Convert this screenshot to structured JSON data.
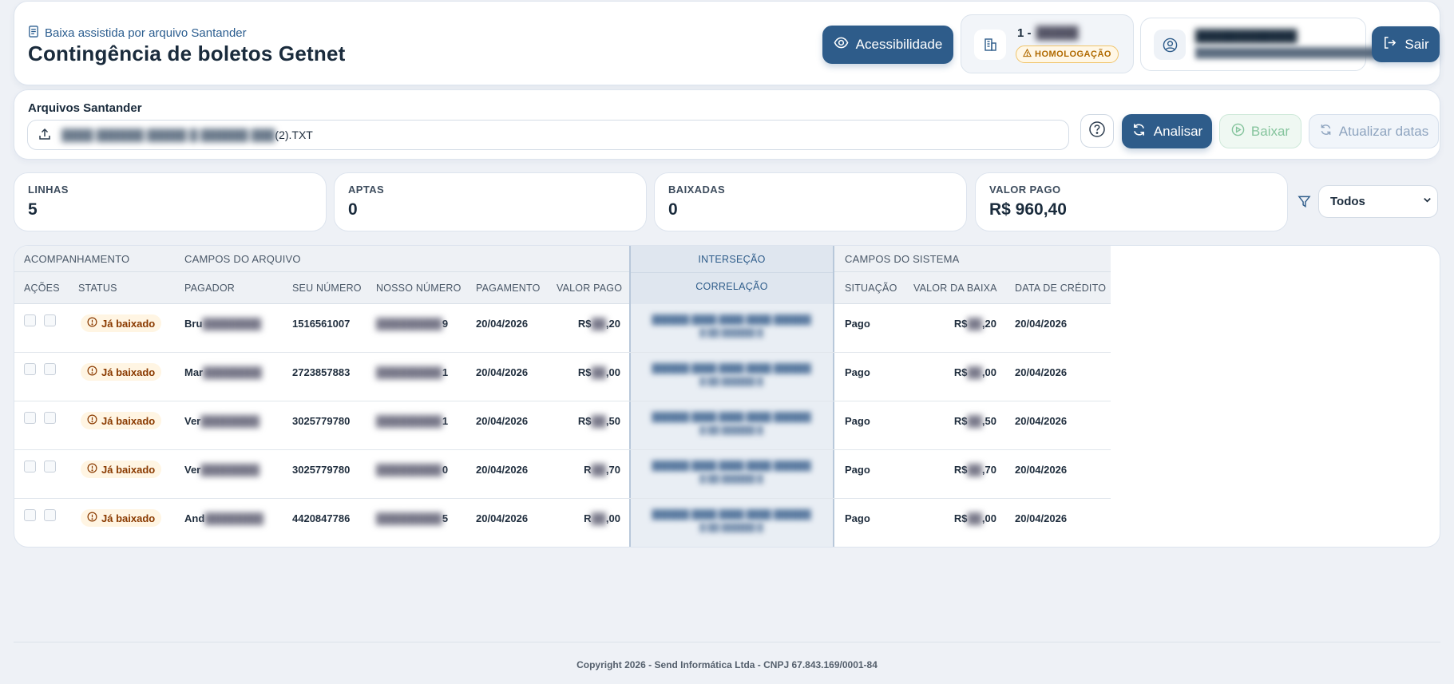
{
  "header": {
    "subtitle": "Baixa assistida por arquivo Santander",
    "title": "Contingência de boletos Getnet",
    "accessibility_label": "Acessibilidade",
    "company_code": "1 -",
    "company_name": "",
    "environment_badge": "HOMOLOGAÇÃO",
    "user_name": "",
    "user_email": "",
    "exit_label": "Sair"
  },
  "file_panel": {
    "label": "Arquivos Santander",
    "file_name_suffix": "(2).TXT",
    "analyze_label": "Analisar",
    "download_label": "Baixar",
    "update_dates_label": "Atualizar datas"
  },
  "stats": [
    {
      "label": "LINHAS",
      "value": "5"
    },
    {
      "label": "APTAS",
      "value": "0"
    },
    {
      "label": "BAIXADAS",
      "value": "0"
    },
    {
      "label": "VALOR PAGO",
      "value": "R$ 960,40"
    }
  ],
  "filter": {
    "selected": "Todos"
  },
  "table": {
    "groups": {
      "tracking": "ACOMPANHAMENTO",
      "file_fields": "CAMPOS DO ARQUIVO",
      "intersection": "INTERSEÇÃO",
      "system_fields": "CAMPOS DO SISTEMA"
    },
    "columns": {
      "actions": "AÇÕES",
      "status": "STATUS",
      "payer": "PAGADOR",
      "seu_numero": "SEU NÚMERO",
      "nosso_numero": "NOSSO NÚMERO",
      "payment": "PAGAMENTO",
      "paid_value": "VALOR PAGO",
      "correlation": "CORRELAÇÃO",
      "situation": "SITUAÇÃO",
      "write_off_value": "VALOR DA BAIXA",
      "credit_date": "DATA DE CRÉDITO"
    },
    "rows": [
      {
        "status": "Já baixado",
        "payer": "Bru",
        "seu_numero": "1516561007",
        "nosso_numero_end": "9",
        "payment": "20/04/2026",
        "paid_value_prefix": "R$",
        "paid_value_suffix": ",20",
        "situation": "Pago",
        "write_off_prefix": "R$",
        "write_off_suffix": ",20",
        "credit_date": "20/04/2026"
      },
      {
        "status": "Já baixado",
        "payer": "Mar",
        "seu_numero": "2723857883",
        "nosso_numero_end": "1",
        "payment": "20/04/2026",
        "paid_value_prefix": "R$",
        "paid_value_suffix": ",00",
        "situation": "Pago",
        "write_off_prefix": "R$",
        "write_off_suffix": ",00",
        "credit_date": "20/04/2026"
      },
      {
        "status": "Já baixado",
        "payer": "Ver",
        "seu_numero": "3025779780",
        "nosso_numero_end": "1",
        "payment": "20/04/2026",
        "paid_value_prefix": "R$",
        "paid_value_suffix": ",50",
        "situation": "Pago",
        "write_off_prefix": "R$",
        "write_off_suffix": ",50",
        "credit_date": "20/04/2026"
      },
      {
        "status": "Já baixado",
        "payer": "Ver",
        "seu_numero": "3025779780",
        "nosso_numero_end": "0",
        "payment": "20/04/2026",
        "paid_value_prefix": "R",
        "paid_value_suffix": ",70",
        "situation": "Pago",
        "write_off_prefix": "R$",
        "write_off_suffix": ",70",
        "credit_date": "20/04/2026"
      },
      {
        "status": "Já baixado",
        "payer": "And",
        "seu_numero": "4420847786",
        "nosso_numero_end": "5",
        "payment": "20/04/2026",
        "paid_value_prefix": "R",
        "paid_value_suffix": ",00",
        "situation": "Pago",
        "write_off_prefix": "R$",
        "write_off_suffix": ",00",
        "credit_date": "20/04/2026"
      }
    ]
  },
  "footer": {
    "text": "Copyright 2026 - Send Informática Ltda - CNPJ 67.843.169/0001-84"
  },
  "colors": {
    "primary": "#2e5c8a",
    "status_text": "#8a3a00",
    "status_bg": "#fff5e3",
    "environment": "#b06a00"
  }
}
